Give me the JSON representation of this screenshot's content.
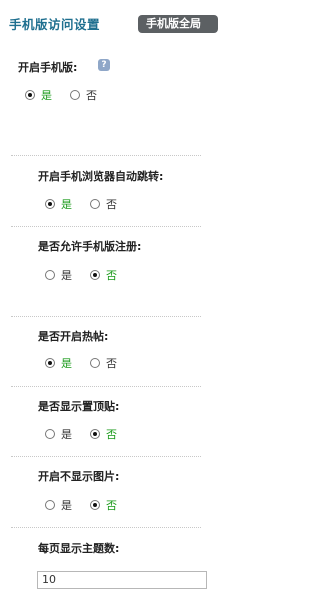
{
  "header": {
    "title": "手机版访问设置",
    "badge": "手机版全局"
  },
  "settings": [
    {
      "label": "开启手机版:",
      "has_help": true,
      "options": [
        "是",
        "否"
      ],
      "selected": 0
    },
    {
      "label": "开启手机浏览器自动跳转:",
      "options": [
        "是",
        "否"
      ],
      "selected": 0
    },
    {
      "label": "是否允许手机版注册:",
      "options": [
        "是",
        "否"
      ],
      "selected": 1
    },
    {
      "label": "是否开启热帖:",
      "options": [
        "是",
        "否"
      ],
      "selected": 0
    },
    {
      "label": "是否显示置顶贴:",
      "options": [
        "是",
        "否"
      ],
      "selected": 1
    },
    {
      "label": "开启不显示图片:",
      "options": [
        "是",
        "否"
      ],
      "selected": 1
    },
    {
      "label": "每页显示主题数:",
      "value": "10"
    }
  ],
  "help_icon": {
    "name": "help-icon",
    "glyph": "?"
  },
  "colors": {
    "title": "#1f6f8f",
    "selected_option": "#1a9a1a",
    "badge_bg": "#5c6063"
  }
}
